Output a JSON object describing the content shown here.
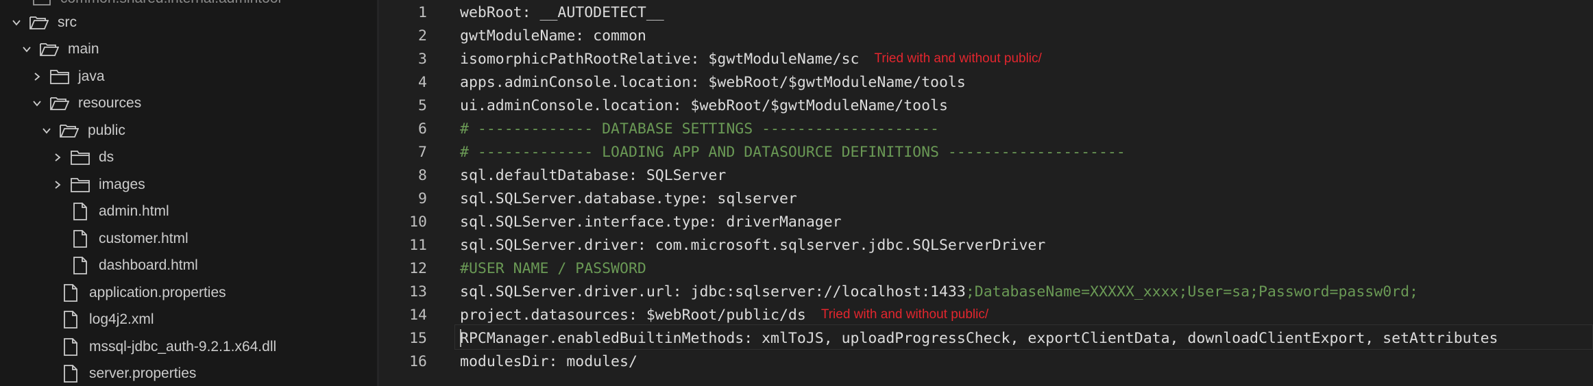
{
  "explorer": {
    "top_cut_label": "common.shared.internal.admintool",
    "items": [
      {
        "label": "src",
        "type": "folder",
        "open": true
      },
      {
        "label": "main",
        "type": "folder",
        "open": true
      },
      {
        "label": "java",
        "type": "folder",
        "open": false
      },
      {
        "label": "resources",
        "type": "folder",
        "open": true
      },
      {
        "label": "public",
        "type": "folder",
        "open": true
      },
      {
        "label": "ds",
        "type": "folder",
        "open": false
      },
      {
        "label": "images",
        "type": "folder",
        "open": false
      },
      {
        "label": "admin.html",
        "type": "file"
      },
      {
        "label": "customer.html",
        "type": "file"
      },
      {
        "label": "dashboard.html",
        "type": "file"
      },
      {
        "label": "application.properties",
        "type": "file"
      },
      {
        "label": "log4j2.xml",
        "type": "file"
      },
      {
        "label": "mssql-jdbc_auth-9.2.1.x64.dll",
        "type": "file"
      },
      {
        "label": "server.properties",
        "type": "file"
      }
    ]
  },
  "editor": {
    "lines": [
      {
        "n": "1",
        "text": "webRoot: __AUTODETECT__"
      },
      {
        "n": "2",
        "text": "gwtModuleName: common"
      },
      {
        "n": "3",
        "text": "isomorphicPathRootRelative: $gwtModuleName/sc",
        "note": "Tried with and without public/"
      },
      {
        "n": "4",
        "text": "apps.adminConsole.location: $webRoot/$gwtModuleName/tools"
      },
      {
        "n": "5",
        "text": "ui.adminConsole.location: $webRoot/$gwtModuleName/tools"
      },
      {
        "n": "6",
        "comment": "# ------------- DATABASE SETTINGS --------------------"
      },
      {
        "n": "7",
        "comment": "# ------------- LOADING APP AND DATASOURCE DEFINITIONS --------------------"
      },
      {
        "n": "8",
        "text": "sql.defaultDatabase: SQLServer"
      },
      {
        "n": "9",
        "text": "sql.SQLServer.database.type: sqlserver"
      },
      {
        "n": "10",
        "text": "sql.SQLServer.interface.type: driverManager"
      },
      {
        "n": "11",
        "text": "sql.SQLServer.driver: com.microsoft.sqlserver.jdbc.SQLServerDriver"
      },
      {
        "n": "12",
        "comment": "#USER NAME / PASSWORD"
      },
      {
        "n": "13",
        "text": "sql.SQLServer.driver.url: jdbc:sqlserver://localhost:1433",
        "comment": ";DatabaseName=XXXXX_xxxx;User=sa;Password=passw0rd;"
      },
      {
        "n": "14",
        "text": "project.datasources: $webRoot/public/ds",
        "note": "Tried with and without public/"
      },
      {
        "n": "15",
        "text": "RPCManager.enabledBuiltinMethods: xmlToJS, uploadProgressCheck, exportClientData, downloadClientExport, setAttributes"
      },
      {
        "n": "16",
        "text": "modulesDir: modules/"
      }
    ]
  },
  "colors": {
    "sidebar_bg": "#181818",
    "editor_bg": "#1f1f1f",
    "text": "#dcdcdc",
    "comment": "#6a9955",
    "annotation": "#e3262e"
  }
}
